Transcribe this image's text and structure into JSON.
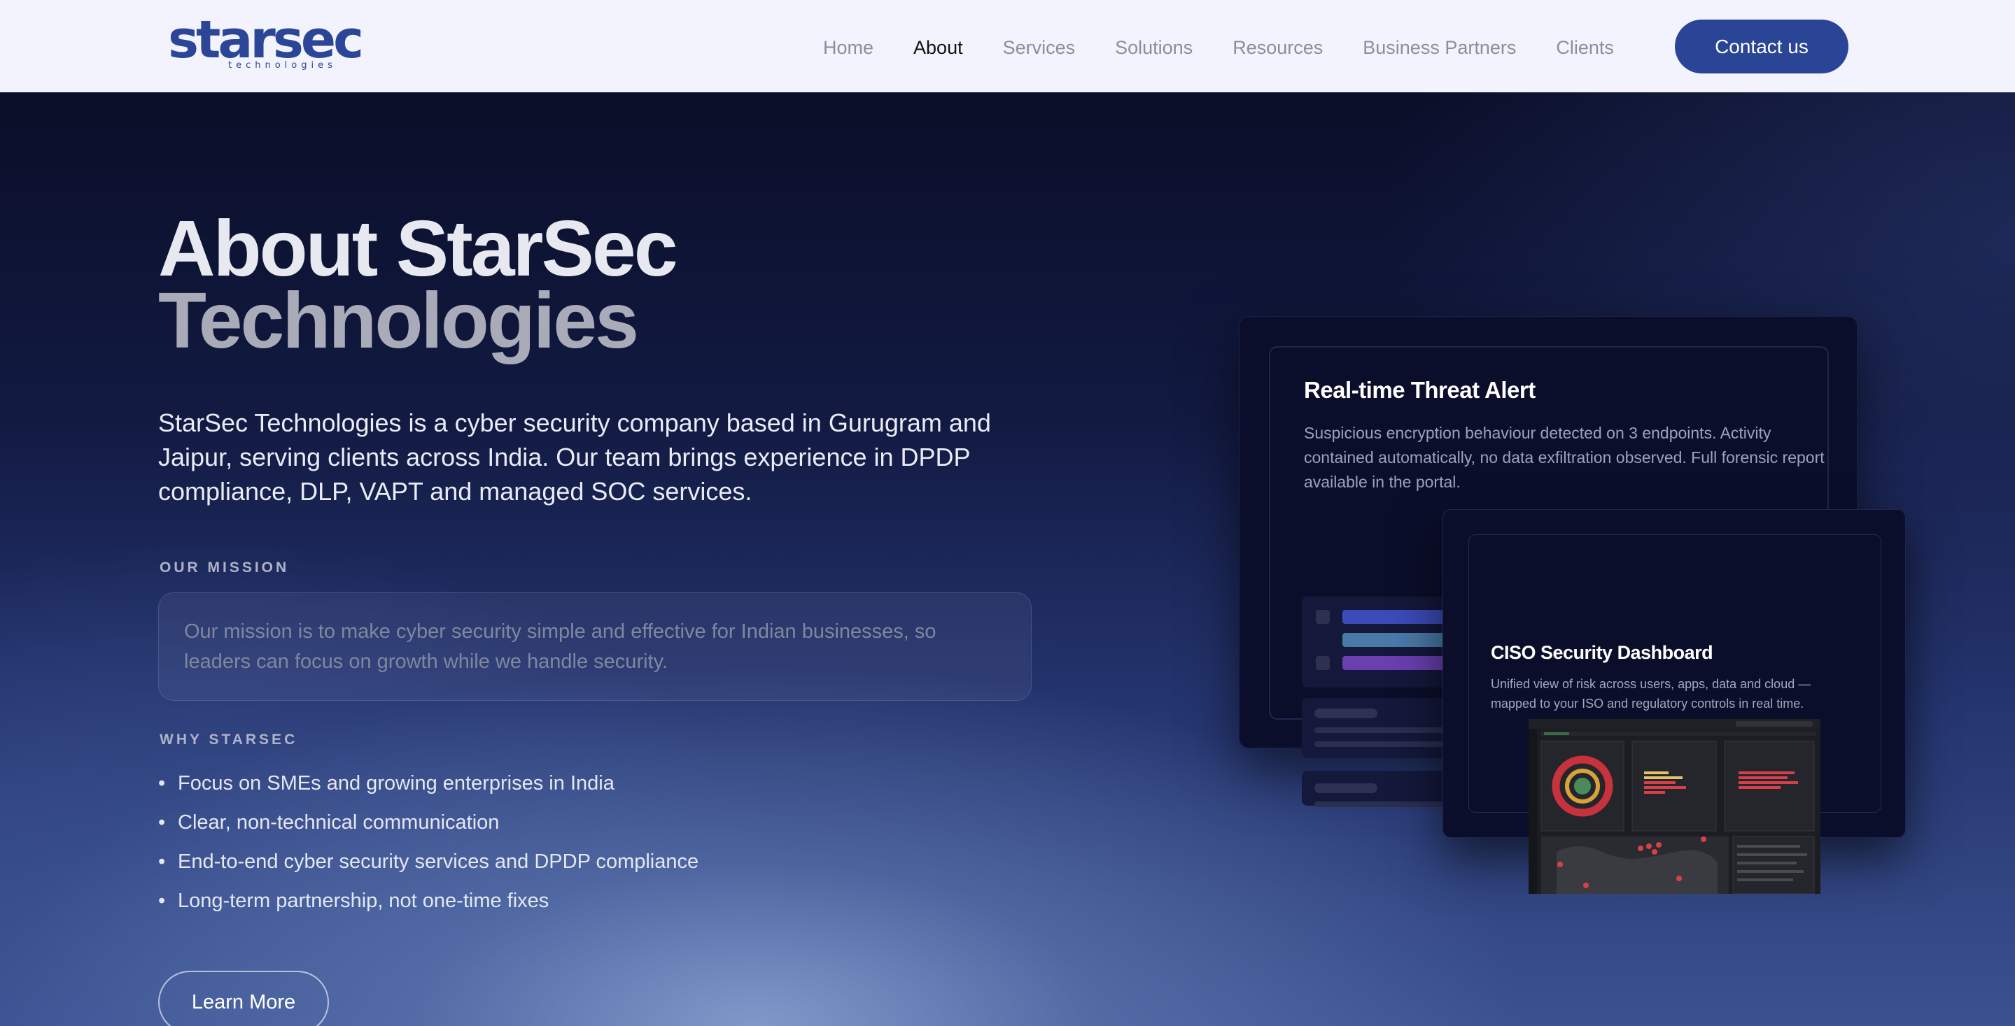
{
  "nav": {
    "logo_text": "starsec",
    "logo_subtext": "technologies",
    "items": [
      {
        "label": "Home",
        "active": false
      },
      {
        "label": "About",
        "active": true
      },
      {
        "label": "Services",
        "active": false
      },
      {
        "label": "Solutions",
        "active": false
      },
      {
        "label": "Resources",
        "active": false
      },
      {
        "label": "Business Partners",
        "active": false
      },
      {
        "label": "Clients",
        "active": false
      }
    ],
    "cta": "Contact us"
  },
  "hero": {
    "title_line1": "About StarSec",
    "title_line2": "Technologies",
    "intro": "StarSec Technologies is a cyber security company based in Gurugram and Jaipur, serving clients across India. Our team brings experience in DPDP compliance, DLP, VAPT and managed SOC services.",
    "mission_label": "OUR MISSION",
    "mission_text": "Our mission is to make cyber security simple and effective for Indian businesses, so leaders can focus on growth while we handle security.",
    "why_label": "WHY STARSEC",
    "why_items": [
      "Focus on SMEs and growing enterprises in India",
      "Clear, non-technical communication",
      "End-to-end cyber security services and DPDP compliance",
      "Long-term partnership, not one-time fixes"
    ],
    "learn_more": "Learn More"
  },
  "cards": {
    "threat": {
      "title": "Real-time Threat Alert",
      "body": "Suspicious encryption behaviour detected on 3 endpoints. Activity contained automatically, no data exfiltration observed. Full forensic report available in the portal."
    },
    "ciso": {
      "title": "CISO Security Dashboard",
      "body": "Unified view of risk across users, apps, data and cloud — mapped to your ISO and regulatory controls in real time."
    }
  },
  "colors": {
    "brand": "#2b4596",
    "nav_bg": "#f2f3fc",
    "hero_top": "#0a0e28",
    "accent_blue": "#3b4bb8",
    "accent_teal": "#4a79a8",
    "accent_purple": "#6a3fb0",
    "alert_red": "#d7404a"
  }
}
